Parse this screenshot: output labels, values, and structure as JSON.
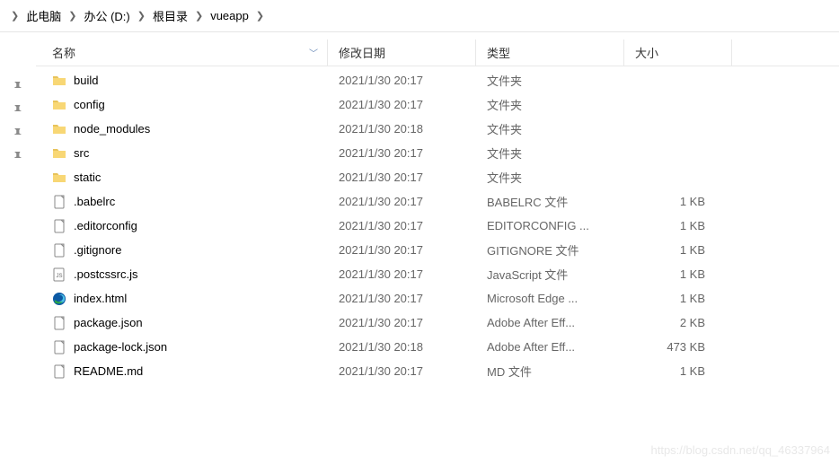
{
  "breadcrumb": [
    "此电脑",
    "办公 (D:)",
    "根目录",
    "vueapp"
  ],
  "columns": {
    "name": "名称",
    "date": "修改日期",
    "type": "类型",
    "size": "大小"
  },
  "rows": [
    {
      "icon": "folder",
      "name": "build",
      "date": "2021/1/30 20:17",
      "type": "文件夹",
      "size": ""
    },
    {
      "icon": "folder",
      "name": "config",
      "date": "2021/1/30 20:17",
      "type": "文件夹",
      "size": ""
    },
    {
      "icon": "folder",
      "name": "node_modules",
      "date": "2021/1/30 20:18",
      "type": "文件夹",
      "size": ""
    },
    {
      "icon": "folder",
      "name": "src",
      "date": "2021/1/30 20:17",
      "type": "文件夹",
      "size": ""
    },
    {
      "icon": "folder",
      "name": "static",
      "date": "2021/1/30 20:17",
      "type": "文件夹",
      "size": ""
    },
    {
      "icon": "file",
      "name": ".babelrc",
      "date": "2021/1/30 20:17",
      "type": "BABELRC 文件",
      "size": "1 KB"
    },
    {
      "icon": "file",
      "name": ".editorconfig",
      "date": "2021/1/30 20:17",
      "type": "EDITORCONFIG ...",
      "size": "1 KB"
    },
    {
      "icon": "file",
      "name": ".gitignore",
      "date": "2021/1/30 20:17",
      "type": "GITIGNORE 文件",
      "size": "1 KB"
    },
    {
      "icon": "js",
      "name": ".postcssrc.js",
      "date": "2021/1/30 20:17",
      "type": "JavaScript 文件",
      "size": "1 KB"
    },
    {
      "icon": "edge",
      "name": "index.html",
      "date": "2021/1/30 20:17",
      "type": "Microsoft Edge ...",
      "size": "1 KB"
    },
    {
      "icon": "file",
      "name": "package.json",
      "date": "2021/1/30 20:17",
      "type": "Adobe After Eff...",
      "size": "2 KB"
    },
    {
      "icon": "file",
      "name": "package-lock.json",
      "date": "2021/1/30 20:18",
      "type": "Adobe After Eff...",
      "size": "473 KB"
    },
    {
      "icon": "file",
      "name": "README.md",
      "date": "2021/1/30 20:17",
      "type": "MD 文件",
      "size": "1 KB"
    }
  ],
  "pins": 4,
  "watermark": "https://blog.csdn.net/qq_46337964"
}
